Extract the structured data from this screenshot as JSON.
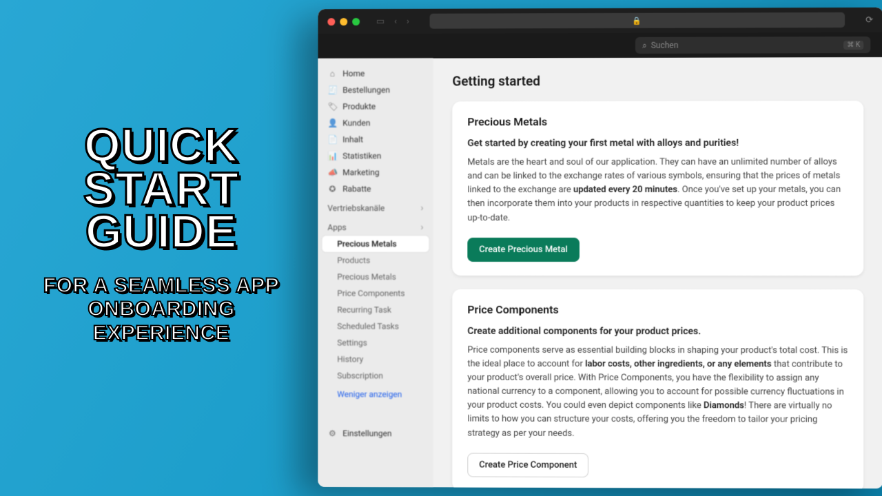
{
  "overlay": {
    "title": "QUICK START GUIDE",
    "subtitle": "FOR A SEAMLESS APP ONBOARDING EXPERIENCE"
  },
  "browser": {
    "url_lock": "🔒",
    "refresh": "⟳"
  },
  "search": {
    "icon": "⌕",
    "placeholder": "Suchen",
    "shortcut": "⌘ K"
  },
  "sidebar": {
    "nav": [
      {
        "icon": "⌂",
        "label": "Home"
      },
      {
        "icon": "🧾",
        "label": "Bestellungen"
      },
      {
        "icon": "🏷",
        "label": "Produkte"
      },
      {
        "icon": "👤",
        "label": "Kunden"
      },
      {
        "icon": "📄",
        "label": "Inhalt"
      },
      {
        "icon": "📊",
        "label": "Statistiken"
      },
      {
        "icon": "📣",
        "label": "Marketing"
      },
      {
        "icon": "✪",
        "label": "Rabatte"
      }
    ],
    "channels_header": "Vertriebskanäle",
    "apps_header": "Apps",
    "apps": [
      {
        "label": "Precious Metals",
        "active": true
      },
      {
        "label": "Products"
      },
      {
        "label": "Precious Metals"
      },
      {
        "label": "Price Components"
      },
      {
        "label": "Recurring Task"
      },
      {
        "label": "Scheduled Tasks"
      },
      {
        "label": "Settings"
      },
      {
        "label": "History"
      },
      {
        "label": "Subscription"
      }
    ],
    "show_less": "Weniger anzeigen",
    "settings": {
      "icon": "⚙",
      "label": "Einstellungen"
    }
  },
  "main": {
    "title": "Getting started",
    "card1": {
      "heading": "Precious Metals",
      "lead": "Get started by creating your first metal with alloys and purities!",
      "body_prefix": "Metals are the heart and soul of our application. They can have an unlimited number of alloys and can be linked to the exchange rates of various symbols, ensuring that the prices of metals linked to the exchange are ",
      "bold1": "updated every 20 minutes",
      "body_suffix": ". Once you've set up your metals, you can then incorporate them into your products in respective quantities to keep your product prices up-to-date.",
      "button": "Create Precious Metal"
    },
    "card2": {
      "heading": "Price Components",
      "lead": "Create additional components for your product prices.",
      "body_p1": "Price components serve as essential building blocks in shaping your product's total cost. This is the ideal place to account for ",
      "bold1": "labor costs, other ingredients, or any elements",
      "body_p2": " that contribute to your product's overall price. With Price Components, you have the flexibility to assign any national currency to a component, allowing you to account for possible currency fluctuations in your product costs. You could even depict components like ",
      "bold2": "Diamonds",
      "body_p3": "! There are virtually no limits to how you can structure your costs, offering you the freedom to tailor your pricing strategy as per your needs.",
      "button": "Create Price Component"
    }
  }
}
